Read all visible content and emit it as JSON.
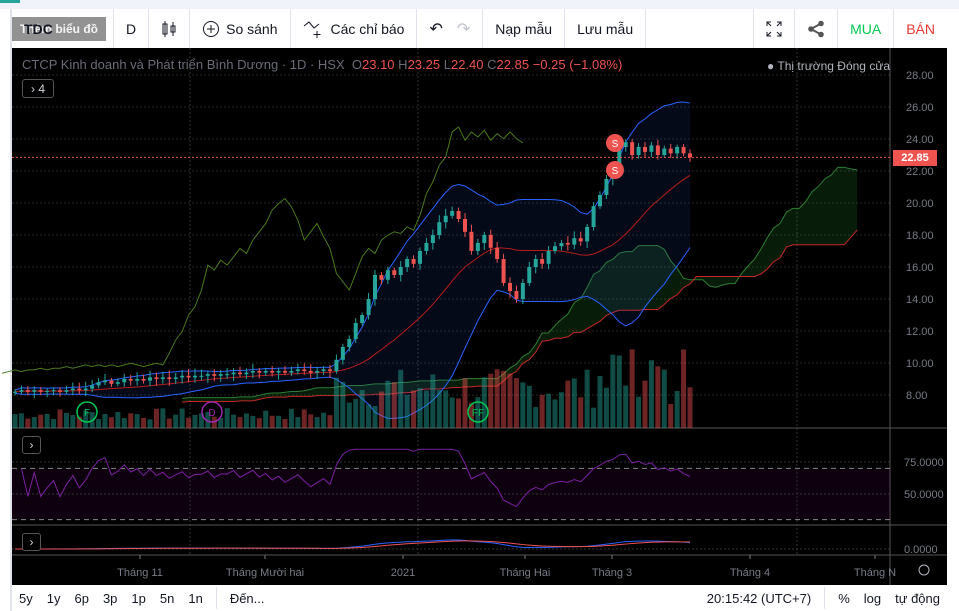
{
  "toolbar": {
    "symbol": "TDC",
    "tooltip": "Thêm biểu đồ",
    "interval": "D",
    "compare": "So sánh",
    "indicators": "Các chỉ báo",
    "load_template": "Nạp mẫu",
    "save_template": "Lưu mẫu",
    "buy": "MUA",
    "sell": "BÁN"
  },
  "legend": {
    "title": "CTCP Kinh doanh và Phát triển Bình Dương · 1D · HSX",
    "o_label": "O",
    "o": "23.10",
    "h_label": "H",
    "h": "23.25",
    "l_label": "L",
    "l": "22.40",
    "c_label": "C",
    "c": "22.85",
    "change": "−0.25 (−1.08%)",
    "market_status": "Thị trường Đóng cửa",
    "indicators_count": "4"
  },
  "colors": {
    "up": "#26a69a",
    "down": "#ef5350",
    "buy": "#00c853",
    "sell": "#e53935"
  },
  "chart_data": {
    "type": "candlestick",
    "last_price": "22.85",
    "price_ticks": [
      "28.00",
      "26.00",
      "24.00",
      "22.00",
      "20.00",
      "18.00",
      "16.00",
      "14.00",
      "12.00",
      "10.00",
      "8.00"
    ],
    "rsi_ticks": [
      "75.0000",
      "50.0000"
    ],
    "macd_ticks": [
      "0.0000"
    ],
    "time_labels": [
      "Tháng 11",
      "Tháng Mười hai",
      "2021",
      "Tháng Hai",
      "Tháng 3",
      "Tháng 4",
      "Tháng N"
    ],
    "markers": [
      {
        "label": "F"
      },
      {
        "label": "D"
      },
      {
        "label": "FF"
      },
      {
        "label": "S"
      },
      {
        "label": "S"
      }
    ],
    "closes": [
      8.2,
      8.3,
      8.2,
      8.3,
      8.2,
      8.25,
      8.3,
      8.2,
      8.3,
      8.4,
      8.3,
      8.4,
      8.6,
      8.8,
      8.9,
      8.7,
      8.8,
      9.0,
      8.9,
      9.0,
      8.9,
      9.1,
      9.0,
      9.1,
      9.0,
      9.1,
      9.2,
      9.1,
      9.2,
      9.2,
      9.3,
      9.2,
      9.3,
      9.3,
      9.4,
      9.3,
      9.4,
      9.5,
      9.4,
      9.5,
      9.4,
      9.5,
      9.4,
      9.5,
      9.6,
      9.5,
      9.4,
      9.5,
      9.6,
      9.5,
      10.2,
      11.0,
      11.5,
      12.5,
      13.0,
      14.0,
      15.5,
      15.2,
      15.8,
      15.5,
      16.0,
      16.5,
      16.2,
      17.0,
      17.5,
      18.0,
      18.8,
      19.2,
      19.5,
      19.0,
      18.2,
      17.0,
      17.5,
      18.0,
      17.2,
      16.5,
      15.0,
      14.5,
      14.0,
      15.0,
      16.0,
      16.5,
      16.2,
      17.0,
      17.3,
      17.5,
      17.4,
      17.8,
      17.6,
      18.5,
      19.8,
      20.5,
      21.5,
      22.0,
      23.5,
      23.8,
      23.0,
      23.5,
      23.2,
      23.6,
      23.0,
      23.4,
      23.1,
      23.5,
      23.1,
      22.85
    ]
  },
  "bottom": {
    "ranges": [
      "5y",
      "1y",
      "6p",
      "3p",
      "1p",
      "5n",
      "1n"
    ],
    "goto": "Đến...",
    "time": "20:15:42 (UTC+7)",
    "percent": "%",
    "log": "log",
    "auto": "tự động"
  }
}
